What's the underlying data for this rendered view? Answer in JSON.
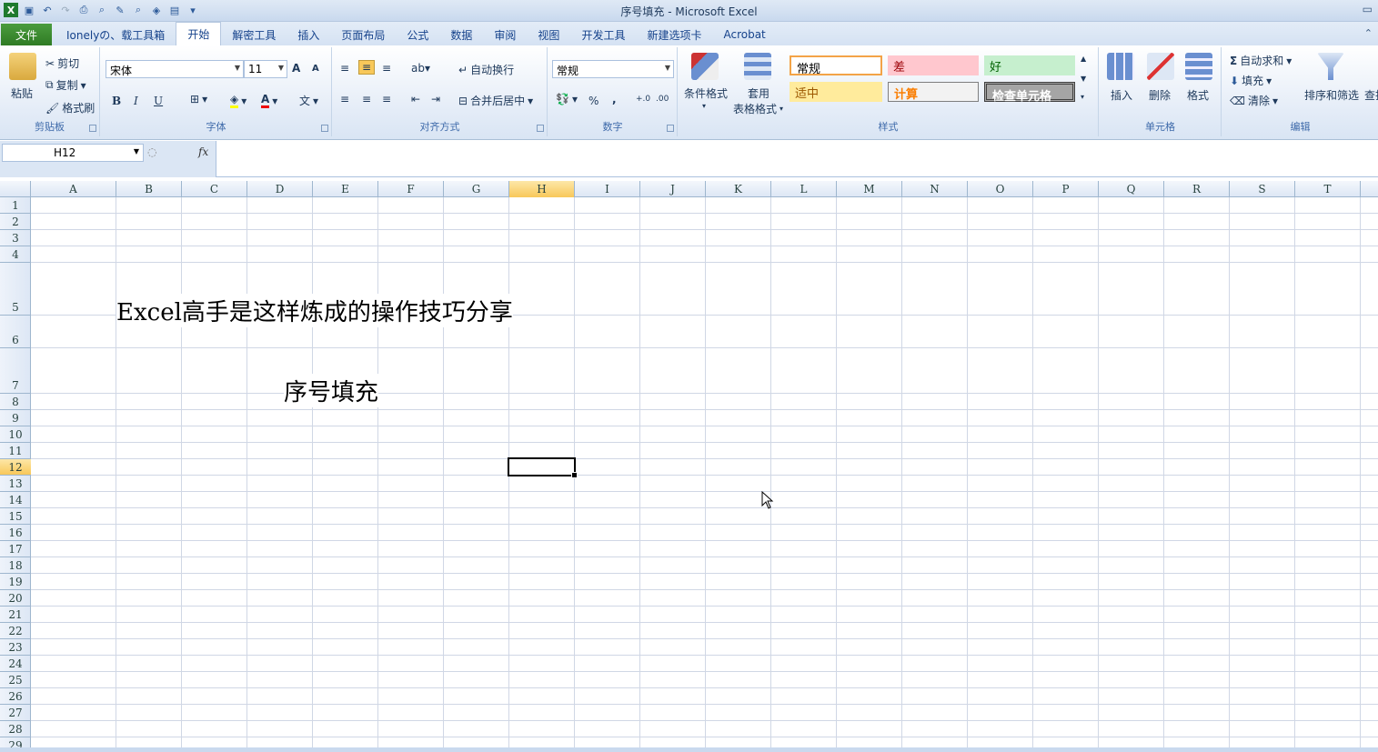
{
  "window": {
    "title": "序号填充 - Microsoft Excel"
  },
  "tabs": [
    "文件",
    "Ionelyの、载工具箱",
    "开始",
    "解密工具",
    "插入",
    "页面布局",
    "公式",
    "数据",
    "审阅",
    "视图",
    "开发工具",
    "新建选项卡",
    "Acrobat"
  ],
  "ribbon": {
    "clipboard": {
      "paste": "粘贴",
      "cut": "剪切",
      "copy": "复制",
      "format_painter": "格式刷",
      "label": "剪贴板"
    },
    "font": {
      "name": "宋体",
      "size": "11",
      "bold": "B",
      "italic": "I",
      "underline": "U",
      "grow": "A",
      "shrink": "A",
      "font_color_letter": "A",
      "label": "字体"
    },
    "alignment": {
      "wrap": "自动换行",
      "merge": "合并后居中",
      "label": "对齐方式"
    },
    "number": {
      "format": "常规",
      "percent": "%",
      "comma": ",",
      "label": "数字"
    },
    "styles": {
      "conditional": "条件格式",
      "table1": "套用",
      "table2": "表格格式",
      "normal": "常规",
      "bad": "差",
      "good": "好",
      "neutral": "适中",
      "calc": "计算",
      "check": "检查单元格",
      "label": "样式"
    },
    "cells": {
      "insert": "插入",
      "delete": "删除",
      "format": "格式",
      "label": "单元格"
    },
    "editing": {
      "autosum": "自动求和",
      "fill": "填充",
      "clear": "清除",
      "sort": "排序和筛选",
      "find": "查找",
      "label": "编辑"
    }
  },
  "formula_bar": {
    "name_box": "H12",
    "fx": "fx",
    "content": ""
  },
  "columns": [
    "A",
    "B",
    "C",
    "D",
    "E",
    "F",
    "G",
    "H",
    "I",
    "J",
    "K",
    "L",
    "M",
    "N",
    "O",
    "P",
    "Q",
    "R",
    "S",
    "T"
  ],
  "selected_column": "H",
  "rows": [
    "1",
    "2",
    "3",
    "4",
    "5",
    "6",
    "7",
    "8",
    "9",
    "10",
    "11",
    "12",
    "13",
    "14",
    "15",
    "16",
    "17",
    "18",
    "19",
    "20",
    "21",
    "22",
    "23",
    "24",
    "25",
    "26",
    "27",
    "28",
    "29"
  ],
  "selected_row": "12",
  "cells": {
    "B5": "Excel高手是这样炼成的操作技巧分享",
    "D7": "序号填充"
  },
  "colors": {
    "accent": "#15428b",
    "file_tab": "#2f7b24",
    "selection": "#f8c85a",
    "grid_line": "#d0d7e5"
  }
}
